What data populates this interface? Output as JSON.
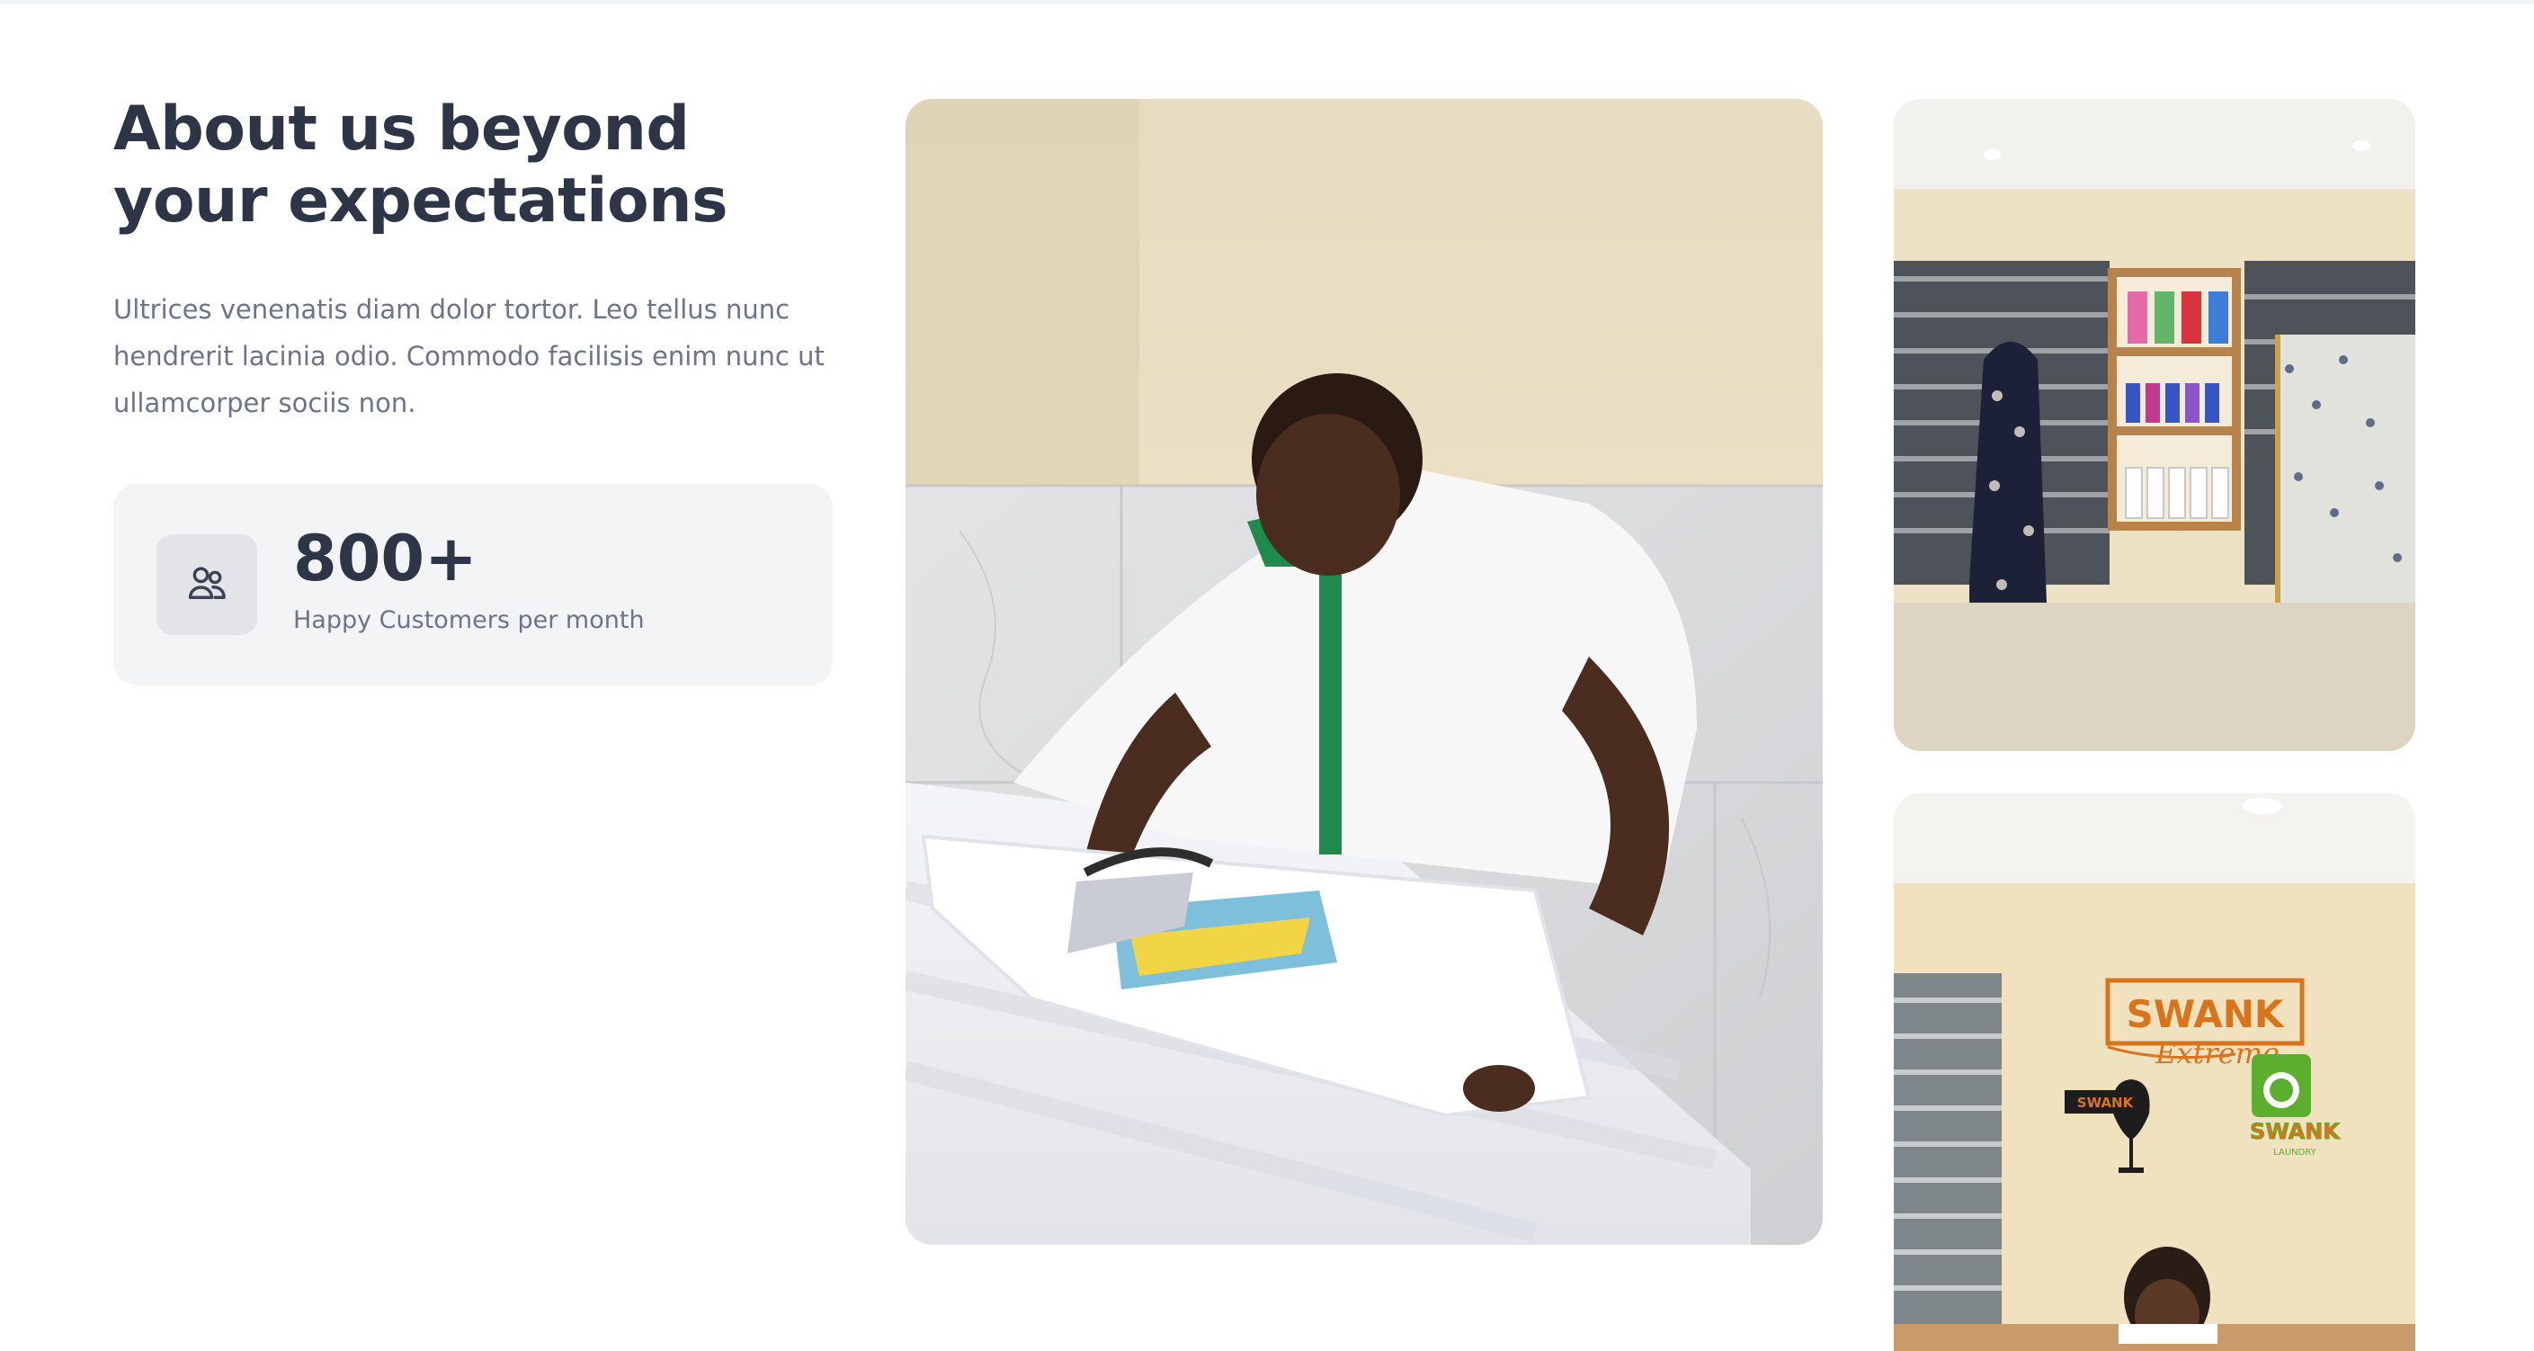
{
  "about": {
    "heading": "About us beyond your expectations",
    "description": "Ultrices venenatis diam dolor tortor. Leo tellus nunc hendrerit lacinia odio. Commodo facilisis enim nunc ut ullamcorper sociis non."
  },
  "stats": {
    "icon": "users-icon",
    "value": "800+",
    "label": "Happy Customers per month"
  },
  "gallery": {
    "reception_logo": {
      "brand": "SWANK",
      "tagline": "Extreme",
      "badge_left": "SWANK",
      "badge_right": "SWANK",
      "badge_right_sub": "LAUNDRY"
    }
  },
  "colors": {
    "heading": "#2d3547",
    "body_text": "#6b7488",
    "card_bg": "#f3f4f6",
    "icon_bg": "#e2e4e8",
    "brand_orange": "#d9741c",
    "brand_green": "#5cae2e"
  }
}
